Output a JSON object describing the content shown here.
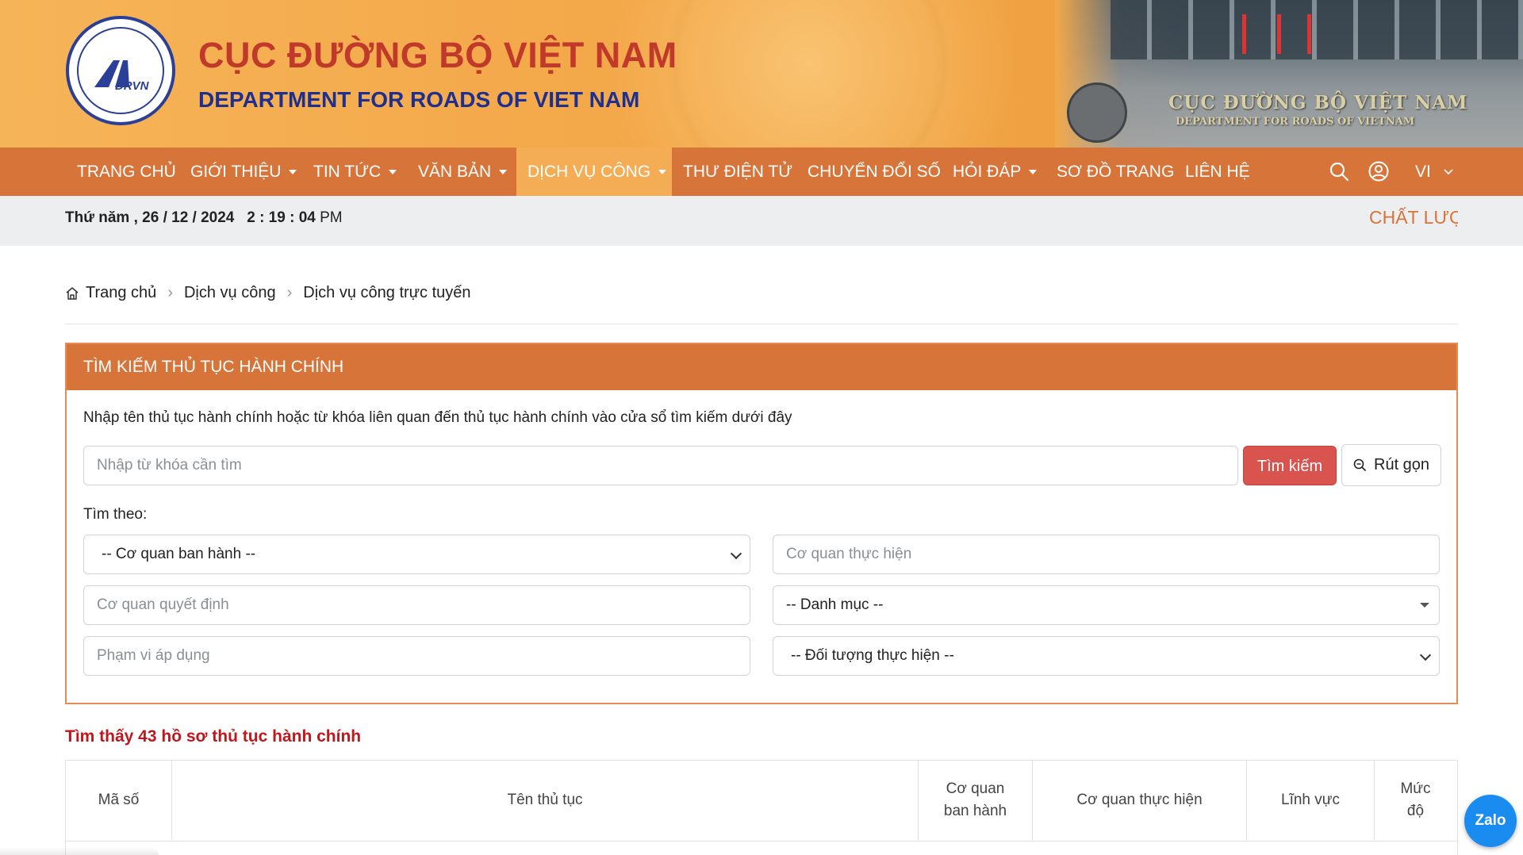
{
  "header": {
    "logo_text": "DRVN",
    "title": "CỤC ĐƯỜNG BỘ VIỆT NAM",
    "subtitle": "DEPARTMENT FOR ROADS OF VIET NAM",
    "photo_sign_title": "CỤC ĐƯỜNG BỘ VIỆT NAM",
    "photo_sign_sub": "DEPARTMENT FOR ROADS OF VIETNAM"
  },
  "nav": {
    "items": [
      {
        "label": "TRANG CHỦ",
        "dropdown": false
      },
      {
        "label": "GIỚI THIỆU",
        "dropdown": true
      },
      {
        "label": "TIN TỨC",
        "dropdown": true
      },
      {
        "label": "VĂN BẢN",
        "dropdown": true
      },
      {
        "label": "DỊCH VỤ CÔNG",
        "dropdown": true,
        "active": true
      },
      {
        "label": "THƯ ĐIỆN TỬ",
        "dropdown": false
      },
      {
        "label": "CHUYỂN ĐỔI SỐ",
        "dropdown": false
      },
      {
        "label": "HỎI ĐÁP",
        "dropdown": true
      },
      {
        "label": "SƠ ĐỒ TRANG",
        "dropdown": false
      },
      {
        "label": "LIÊN HỆ",
        "dropdown": false
      }
    ],
    "search_icon": "search-icon",
    "user_icon": "user-icon",
    "language": "VI"
  },
  "datebar": {
    "date": "Thứ năm , 26 / 12 / 2024",
    "time": "2 : 19 : 04",
    "ampm": "PM",
    "ticker": "CHẤT LƯỢNG"
  },
  "breadcrumb": {
    "home": "Trang chủ",
    "level1": "Dịch vụ công",
    "level2": "Dịch vụ công trực tuyến"
  },
  "search_panel": {
    "title": "TÌM KIẾM THỦ TỤC HÀNH CHÍNH",
    "description": "Nhập tên thủ tục hành chính hoặc từ khóa liên quan đến thủ tục hành chính vào cửa sổ tìm kiếm dưới đây",
    "keyword_placeholder": "Nhập từ khóa cần tìm",
    "search_button": "Tìm kiếm",
    "collapse_button": "Rút gọn",
    "search_by_label": "Tìm theo:",
    "issuing_agency": "-- Cơ quan ban hành --",
    "executing_agency_placeholder": "Cơ quan thực hiện",
    "deciding_agency_placeholder": "Cơ quan quyết định",
    "category": "-- Danh mục --",
    "scope_placeholder": "Phạm vi áp dụng",
    "target": "-- Đối tượng thực hiện --"
  },
  "results": {
    "count_text": "Tìm thấy 43 hồ sơ thủ tục hành chính",
    "columns": [
      "Mã số",
      "Tên thủ tục",
      "Cơ quan ban hành",
      "Cơ quan thực hiện",
      "Lĩnh vực",
      "Mức độ"
    ]
  },
  "zalo_label": "Zalo",
  "colors": {
    "banner": "#f3a94a",
    "nav": "#d7743a",
    "nav_active": "#f5ad55",
    "title_red": "#c0392b",
    "subtitle_blue": "#1f2f8f",
    "search_button": "#d9534f",
    "result_count": "#c0171c"
  }
}
